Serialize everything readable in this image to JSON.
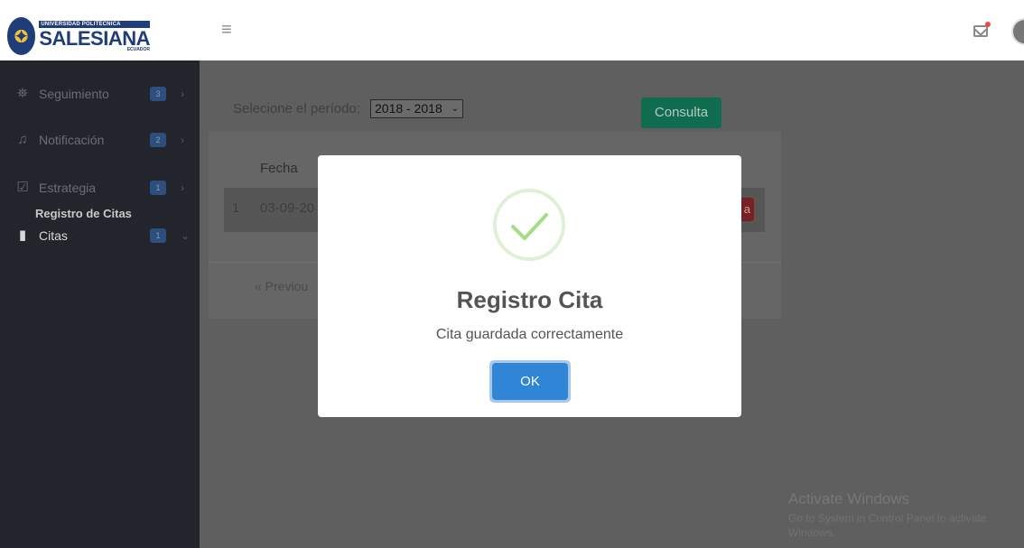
{
  "header": {
    "logo": {
      "line1": "UNIVERSIDAD POLITÉCNICA",
      "line2": "SALESIANA",
      "line3": "ECUADOR"
    },
    "menu_icon": "hamburger-icon",
    "mail_icon": "envelope-icon",
    "notification_dot_color": "#e74c3c"
  },
  "sidebar": {
    "items": [
      {
        "label": "Seguimiento",
        "badge": "3",
        "icon": "binoculars-icon"
      },
      {
        "label": "Notificación",
        "badge": "2",
        "icon": "bell-icon"
      },
      {
        "label": "Estrategia",
        "badge": "1",
        "icon": "check-square-icon"
      },
      {
        "label": "Citas",
        "badge": "1",
        "icon": "book-icon"
      }
    ],
    "submenu_item": "Registro de Citas"
  },
  "main": {
    "period_label": "Selecione el período:",
    "period_value": "2018 - 2018",
    "consulta_button": "Consulta",
    "table": {
      "header_fecha": "Fecha",
      "row_number": "1",
      "row_date": "03-09-20",
      "row_button": "a"
    },
    "pager_previous": "« Previou"
  },
  "modal": {
    "title": "Registro Cita",
    "message": "Cita guardada correctamente",
    "ok_button": "OK",
    "icon": "success-check-icon",
    "accent_color": "#3085d6",
    "success_color": "#a5dc86"
  },
  "watermark": {
    "title": "Activate Windows",
    "subtitle": "Go to System in Control Panel to activate Windows."
  }
}
